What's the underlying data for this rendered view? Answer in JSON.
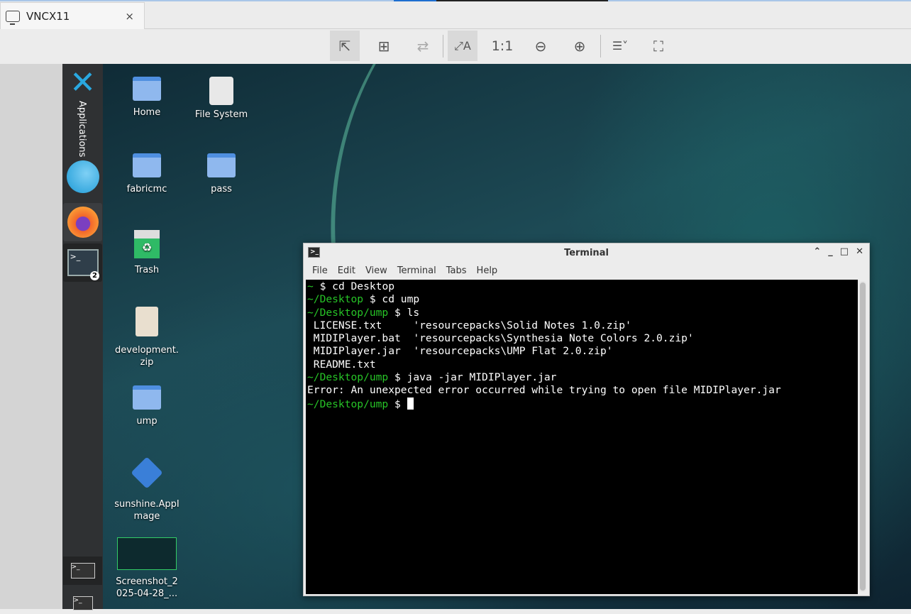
{
  "tab": {
    "title": "VNCX11",
    "close": "×"
  },
  "toolbar": {
    "one_to_one": "1:1"
  },
  "panel": {
    "applications_label": "Applications",
    "badge": "2"
  },
  "desktop_icons": [
    {
      "label": "Home"
    },
    {
      "label": "File System"
    },
    {
      "label": "fabricmc"
    },
    {
      "label": "pass"
    },
    {
      "label": "Trash"
    },
    {
      "label": "development.zip"
    },
    {
      "label": "ump"
    },
    {
      "label": "sunshine.AppImage"
    },
    {
      "label": "Screenshot_2025-04-28_..."
    }
  ],
  "terminal": {
    "title": "Terminal",
    "menu": [
      "File",
      "Edit",
      "View",
      "Terminal",
      "Tabs",
      "Help"
    ],
    "lines": [
      {
        "prompt": "~",
        "cmd": " $ cd Desktop"
      },
      {
        "prompt": "~/Desktop",
        "cmd": " $ cd ump"
      },
      {
        "prompt": "~/Desktop/ump",
        "cmd": " $ ls"
      },
      {
        "prompt": "",
        "cmd": " LICENSE.txt     'resourcepacks\\Solid Notes 1.0.zip'"
      },
      {
        "prompt": "",
        "cmd": " MIDIPlayer.bat  'resourcepacks\\Synthesia Note Colors 2.0.zip'"
      },
      {
        "prompt": "",
        "cmd": " MIDIPlayer.jar  'resourcepacks\\UMP Flat 2.0.zip'"
      },
      {
        "prompt": "",
        "cmd": " README.txt"
      },
      {
        "prompt": "~/Desktop/ump",
        "cmd": " $ java -jar MIDIPlayer.jar"
      },
      {
        "prompt": "",
        "cmd": "Error: An unexpected error occurred while trying to open file MIDIPlayer.jar"
      },
      {
        "prompt": "~/Desktop/ump",
        "cmd": " $ "
      }
    ]
  }
}
